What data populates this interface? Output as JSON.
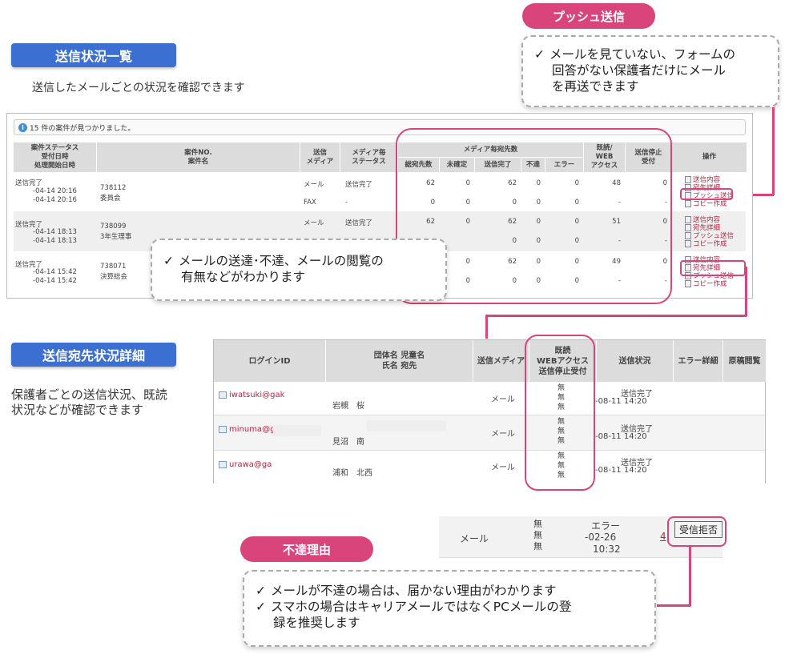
{
  "sections": {
    "status_list": {
      "label": "送信状況一覧",
      "desc": "送信したメールごとの状況を確認できます"
    },
    "recipient_detail": {
      "label": "送信宛先状況詳細",
      "desc_line1": "保護者ごとの送信状況、既読",
      "desc_line2": "状況などが確認できます"
    }
  },
  "callouts": {
    "push": {
      "pill": "プッシュ送信",
      "line1": "メールを見ていない、フォームの",
      "line2": "回答がない保護者だけにメール",
      "line3": "を再送できます"
    },
    "delivery": {
      "line1": "メールの送達･不達、メールの閲覧の",
      "line2": "有無などがわかります"
    },
    "reason": {
      "pill": "不達理由",
      "line1": "メールが不達の場合は、届かない理由がわかります",
      "line2": "スマホの場合はキャリアメールではなくPCメールの登",
      "line3": "録を推奨します"
    },
    "check": "✓"
  },
  "main_table": {
    "found": "15 件の案件が見つかりました。",
    "headers": {
      "status": [
        "案件ステータス",
        "受付日時",
        "処理開始日時"
      ],
      "case": [
        "案件NO.",
        "案件名"
      ],
      "media": [
        "送信",
        "メディア"
      ],
      "media_status": [
        "メディア毎",
        "ステータス"
      ],
      "per_media": "メディア毎宛先数",
      "sub": [
        "総宛先数",
        "未確定",
        "送信完了",
        "不達",
        "エラー"
      ],
      "read": [
        "既読/",
        "WEB",
        "アクセス"
      ],
      "stop": [
        "送信停止",
        "受付"
      ],
      "ops": "操作"
    },
    "cases": [
      {
        "status": "送信完了",
        "date1": "-04-14 20:16",
        "date2": "-04-14 20:16",
        "no": "738112",
        "name": "委員会",
        "rows": [
          {
            "media": "メール",
            "mstatus": "送信完了",
            "total": "62",
            "pending": "0",
            "done": "62",
            "fail": "0",
            "err": "0",
            "read": "48",
            "stop": "0"
          },
          {
            "media": "FAX",
            "mstatus": "-",
            "total": "0",
            "pending": "0",
            "done": "0",
            "fail": "0",
            "err": "0",
            "read": "-",
            "stop": "-"
          }
        ],
        "ops": [
          "送信内容",
          "宛先詳細",
          "プッシュ送信",
          "コピー作成"
        ]
      },
      {
        "status": "送信完了",
        "date1": "-04-14 18:13",
        "date2": "-04-14 18:13",
        "no": "738099",
        "name": "3年生理事",
        "rows": [
          {
            "media": "メール",
            "mstatus": "送信完了",
            "total": "62",
            "pending": "0",
            "done": "62",
            "fail": "0",
            "err": "0",
            "read": "51",
            "stop": "0"
          },
          {
            "media": "",
            "mstatus": "",
            "total": "",
            "pending": "",
            "done": "0",
            "fail": "0",
            "err": "0",
            "read": "-",
            "stop": "-"
          }
        ],
        "ops": [
          "送信内容",
          "宛先詳細",
          "プッシュ送信",
          "コピー作成"
        ]
      },
      {
        "status": "送信完了",
        "date1": "-04-14 15:42",
        "date2": "-04-14 15:42",
        "no": "738071",
        "name": "決算総会",
        "rows": [
          {
            "media": "",
            "mstatus": "",
            "total": "",
            "pending": "0",
            "done": "62",
            "fail": "0",
            "err": "0",
            "read": "49",
            "stop": "0"
          },
          {
            "media": "",
            "mstatus": "",
            "total": "",
            "pending": "0",
            "done": "0",
            "fail": "0",
            "err": "0",
            "read": "-",
            "stop": "-"
          }
        ],
        "ops": [
          "送信内容",
          "宛先詳細",
          "プッシュ送信",
          "コピー作成"
        ]
      }
    ]
  },
  "detail_table": {
    "headers": {
      "login": "ログインID",
      "group": [
        "団体名 児童名",
        "氏名 宛先"
      ],
      "media": "送信メディア",
      "read": [
        "既読",
        "WEBアクセス",
        "送信停止受付"
      ],
      "status": "送信状況",
      "error": "エラー詳細",
      "draft": "原稿閲覧"
    },
    "rows": [
      {
        "login": "iwatsuki@gak",
        "name": "岩槻　桜",
        "media": "メール",
        "flags": [
          "無",
          "無",
          "無"
        ],
        "status": "送信完了",
        "date": "-08-11 14:20"
      },
      {
        "login": "minuma@g",
        "name": "見沼　南",
        "media": "メール",
        "flags": [
          "無",
          "無",
          "無"
        ],
        "status": "送信完了",
        "date": "-08-11 14:20"
      },
      {
        "login": "urawa@ga",
        "name": "浦和　北西",
        "media": "メール",
        "flags": [
          "無",
          "無",
          "無"
        ],
        "status": "送信完了",
        "date": "-08-11 14:20"
      }
    ]
  },
  "snippet": {
    "media": "メール",
    "flags": [
      "無",
      "無",
      "無"
    ],
    "status": "エラー",
    "date": "-02-26",
    "time": "10:32",
    "link": "4",
    "reject_button": "受信拒否"
  }
}
